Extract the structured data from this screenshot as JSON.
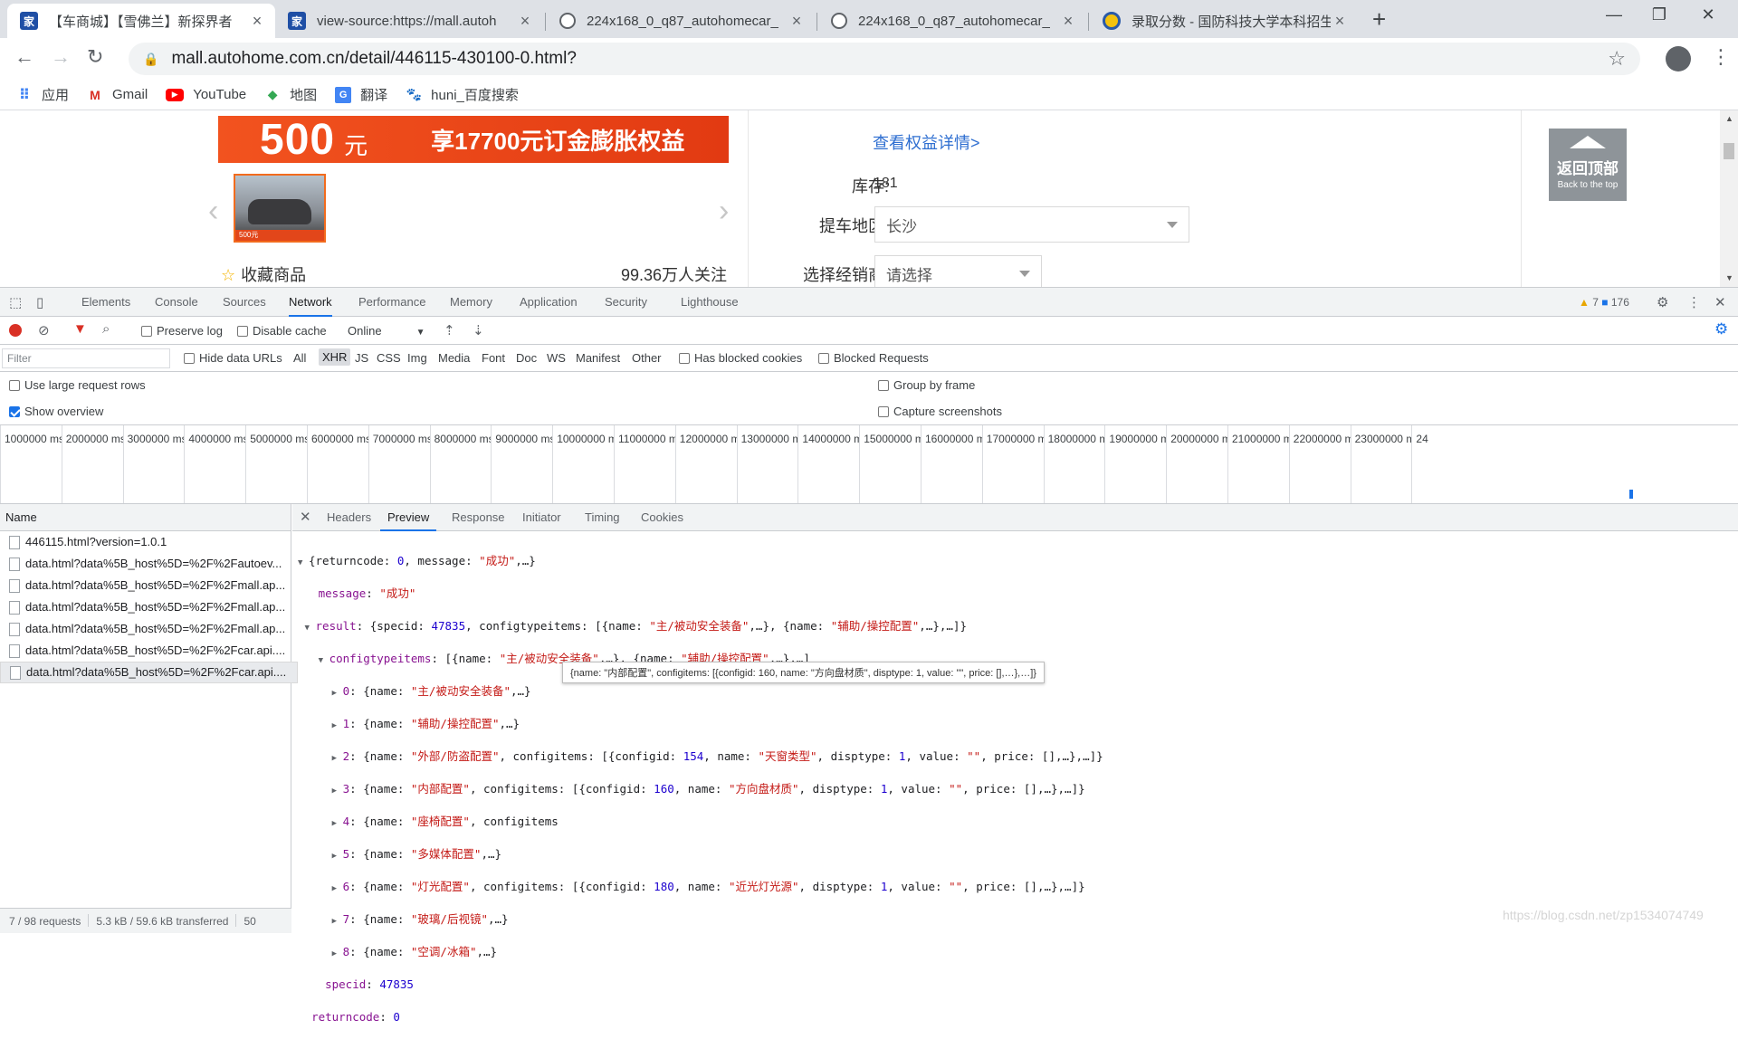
{
  "tabs": [
    {
      "title": "【车商城】【雪佛兰】新探界者",
      "icon": "autohome-icon",
      "active": true
    },
    {
      "title": "view-source:https://mall.autoh",
      "icon": "autohome-icon",
      "active": false
    },
    {
      "title": "224x168_0_q87_autohomecar_",
      "icon": "globe-icon",
      "active": false
    },
    {
      "title": "224x168_0_q87_autohomecar_",
      "icon": "globe-icon",
      "active": false
    },
    {
      "title": "录取分数 - 国防科技大学本科招生",
      "icon": "university-icon",
      "active": false
    }
  ],
  "address": "mall.autohome.com.cn/detail/446115-430100-0.html?",
  "bookmarks": [
    "应用",
    "Gmail",
    "YouTube",
    "地图",
    "翻译",
    "huni_百度搜索"
  ],
  "page": {
    "promo_amount": "500",
    "promo_unit": "元",
    "promo_text": "享17700元订金膨胀权益",
    "thumb_tag": "500元",
    "favorite": "收藏商品",
    "followers": "99.36万人关注",
    "detail_link": "查看权益详情>",
    "stock_label": "库存:",
    "stock_value": "181",
    "region_label": "提车地区:",
    "region_value": "长沙",
    "dealer_label": "选择经销商:",
    "dealer_value": "请选择",
    "back_top": "返回顶部",
    "back_top_en": "Back to the top"
  },
  "devtools": {
    "tabs": [
      "Elements",
      "Console",
      "Sources",
      "Network",
      "Performance",
      "Memory",
      "Application",
      "Security",
      "Lighthouse"
    ],
    "active_tab": "Network",
    "warnings": "7",
    "messages": "176",
    "preserve_log": "Preserve log",
    "disable_cache": "Disable cache",
    "throttle": "Online",
    "filter_placeholder": "Filter",
    "hide_data_urls": "Hide data URLs",
    "types": [
      "All",
      "XHR",
      "JS",
      "CSS",
      "Img",
      "Media",
      "Font",
      "Doc",
      "WS",
      "Manifest",
      "Other"
    ],
    "active_type": "XHR",
    "has_blocked_cookies": "Has blocked cookies",
    "blocked_requests": "Blocked Requests",
    "large_rows": "Use large request rows",
    "group_by_frame": "Group by frame",
    "show_overview": "Show overview",
    "capture_screenshots": "Capture screenshots",
    "overview_ticks": [
      "1000000 ms",
      "2000000 ms",
      "3000000 ms",
      "4000000 ms",
      "5000000 ms",
      "6000000 ms",
      "7000000 ms",
      "8000000 ms",
      "9000000 ms",
      "10000000 ms",
      "11000000 ms",
      "12000000 ms",
      "13000000 ms",
      "14000000 ms",
      "15000000 ms",
      "16000000 ms",
      "17000000 ms",
      "18000000 ms",
      "19000000 ms",
      "20000000 ms",
      "21000000 ms",
      "22000000 ms",
      "23000000 ms",
      "24"
    ],
    "name_header": "Name",
    "requests": [
      "446115.html?version=1.0.1",
      "data.html?data%5B_host%5D=%2F%2Fautoev...",
      "data.html?data%5B_host%5D=%2F%2Fmall.ap...",
      "data.html?data%5B_host%5D=%2F%2Fmall.ap...",
      "data.html?data%5B_host%5D=%2F%2Fmall.ap...",
      "data.html?data%5B_host%5D=%2F%2Fcar.api....",
      "data.html?data%5B_host%5D=%2F%2Fcar.api...."
    ],
    "footer_requests": "7 / 98 requests",
    "footer_transferred": "5.3 kB / 59.6 kB transferred",
    "footer_extra": "50",
    "detail_tabs": [
      "Headers",
      "Preview",
      "Response",
      "Initiator",
      "Timing",
      "Cookies"
    ],
    "active_detail_tab": "Preview",
    "tooltip": "{name: \"内部配置\", configitems: [{configid: 160, name: \"方向盘材质\", disptype: 1, value: \"\", price: [],…},…]}"
  },
  "watermark": "https://blog.csdn.net/zp1534074749"
}
